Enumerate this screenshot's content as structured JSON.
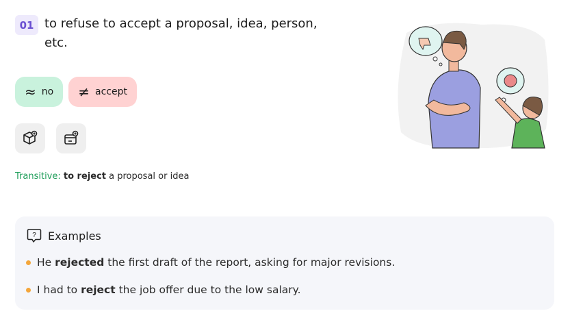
{
  "sense": {
    "number": "01",
    "definition": "to refuse to accept a proposal, idea, person, etc."
  },
  "chips": {
    "synonym": {
      "symbol": "≈",
      "label": "no"
    },
    "antonym": {
      "symbol": "≠",
      "label": "accept"
    }
  },
  "icons": [
    "cube-add-icon",
    "wallet-add-icon"
  ],
  "grammar": {
    "label": "Transitive:",
    "pattern": "to reject",
    "rest": " a proposal or idea"
  },
  "examples": {
    "heading": "Examples",
    "items": [
      {
        "before": "He ",
        "bold": "rejected",
        "after": " the first draft of the report, asking for major revisions."
      },
      {
        "before": "I had to ",
        "bold": "reject",
        "after": " the job offer due to the low salary."
      }
    ]
  },
  "colors": {
    "badge_bg": "#eeeafc",
    "badge_text": "#6a4fd1",
    "synonym_bg": "#c9f2dd",
    "antonym_bg": "#ffd2d2",
    "grammar_label": "#1f9e5a",
    "bullet": "#f4a63a",
    "examples_bg": "#f5f6fa"
  }
}
